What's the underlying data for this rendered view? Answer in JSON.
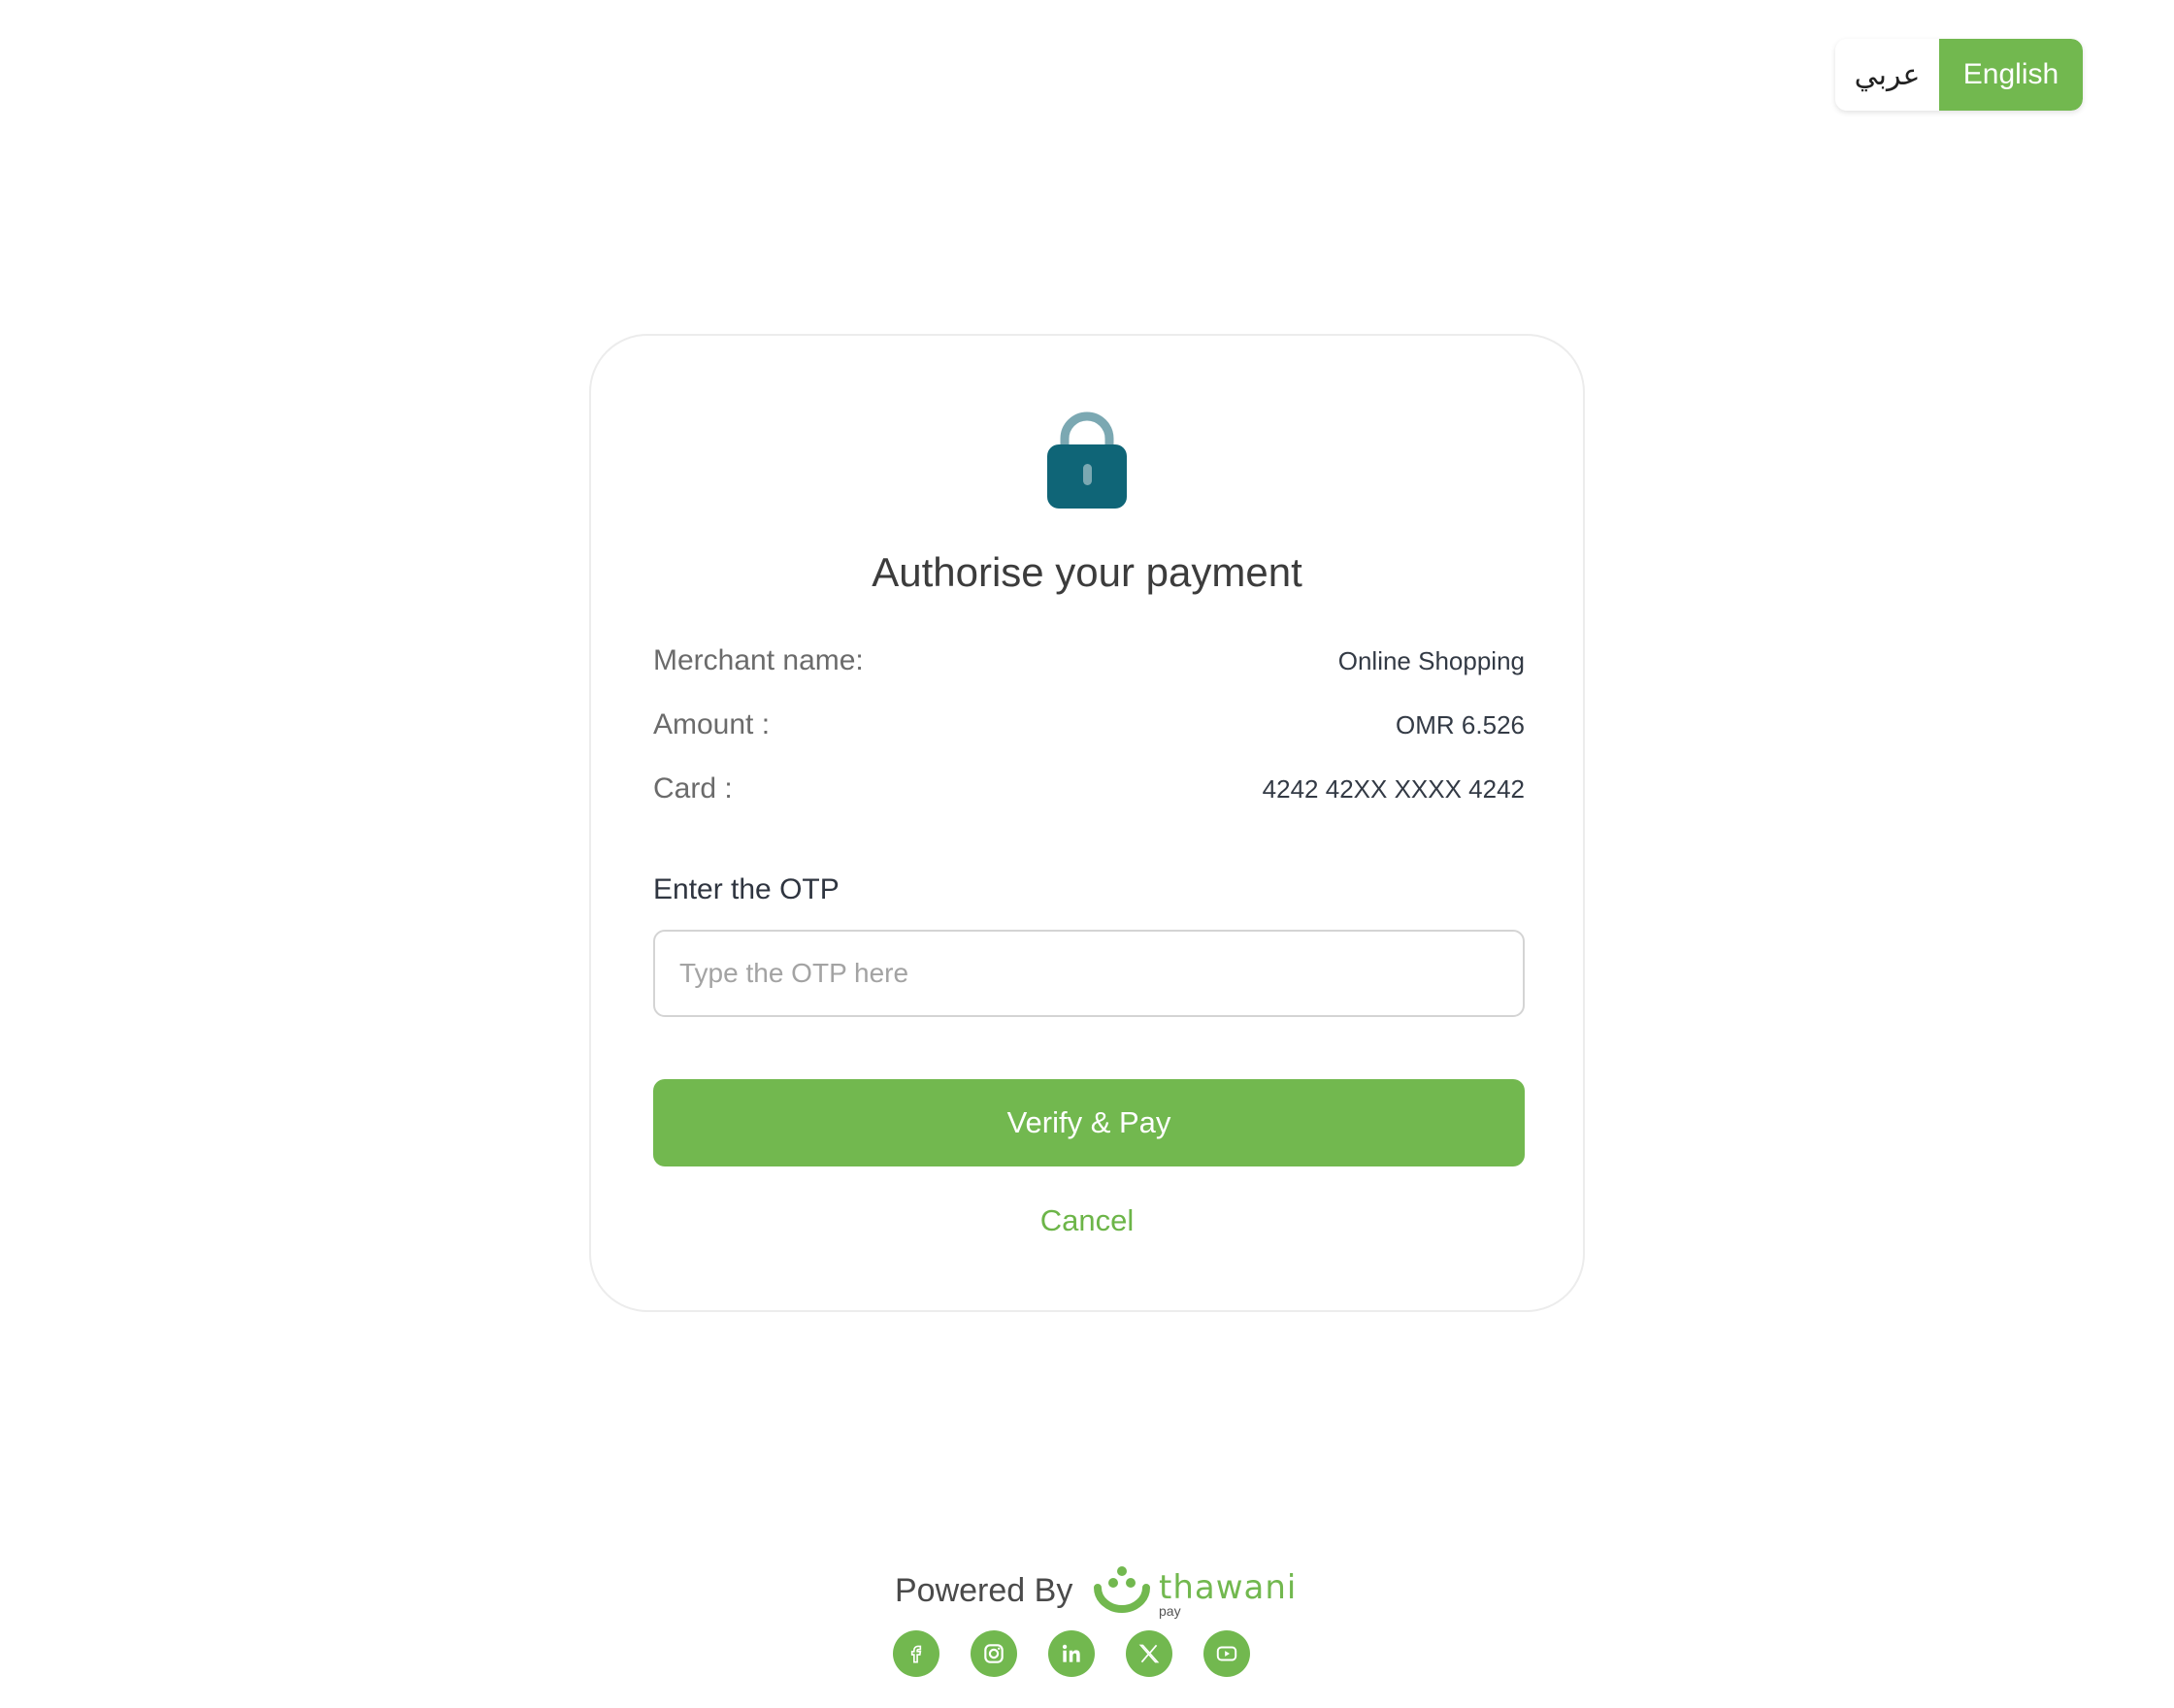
{
  "language": {
    "arabic_label": "عربي",
    "english_label": "English",
    "active": "English"
  },
  "card": {
    "title": "Authorise your payment",
    "merchant_label": "Merchant name:",
    "merchant_value": "Online Shopping",
    "amount_label": "Amount :",
    "amount_value": "OMR 6.526",
    "card_label": "Card :",
    "card_value": "4242 42XX XXXX 4242",
    "otp_label": "Enter the OTP",
    "otp_placeholder": "Type the OTP here",
    "otp_value": "",
    "verify_button": "Verify & Pay",
    "cancel_link": "Cancel"
  },
  "footer": {
    "powered_by": "Powered By",
    "brand_name": "thawani",
    "brand_sub": "pay",
    "social_icons": [
      "facebook-icon",
      "instagram-icon",
      "linkedin-icon",
      "x-icon",
      "youtube-icon"
    ]
  },
  "colors": {
    "accent": "#72b84f",
    "lock": "#0f6577",
    "lock_shackle": "#7ba8b2"
  }
}
